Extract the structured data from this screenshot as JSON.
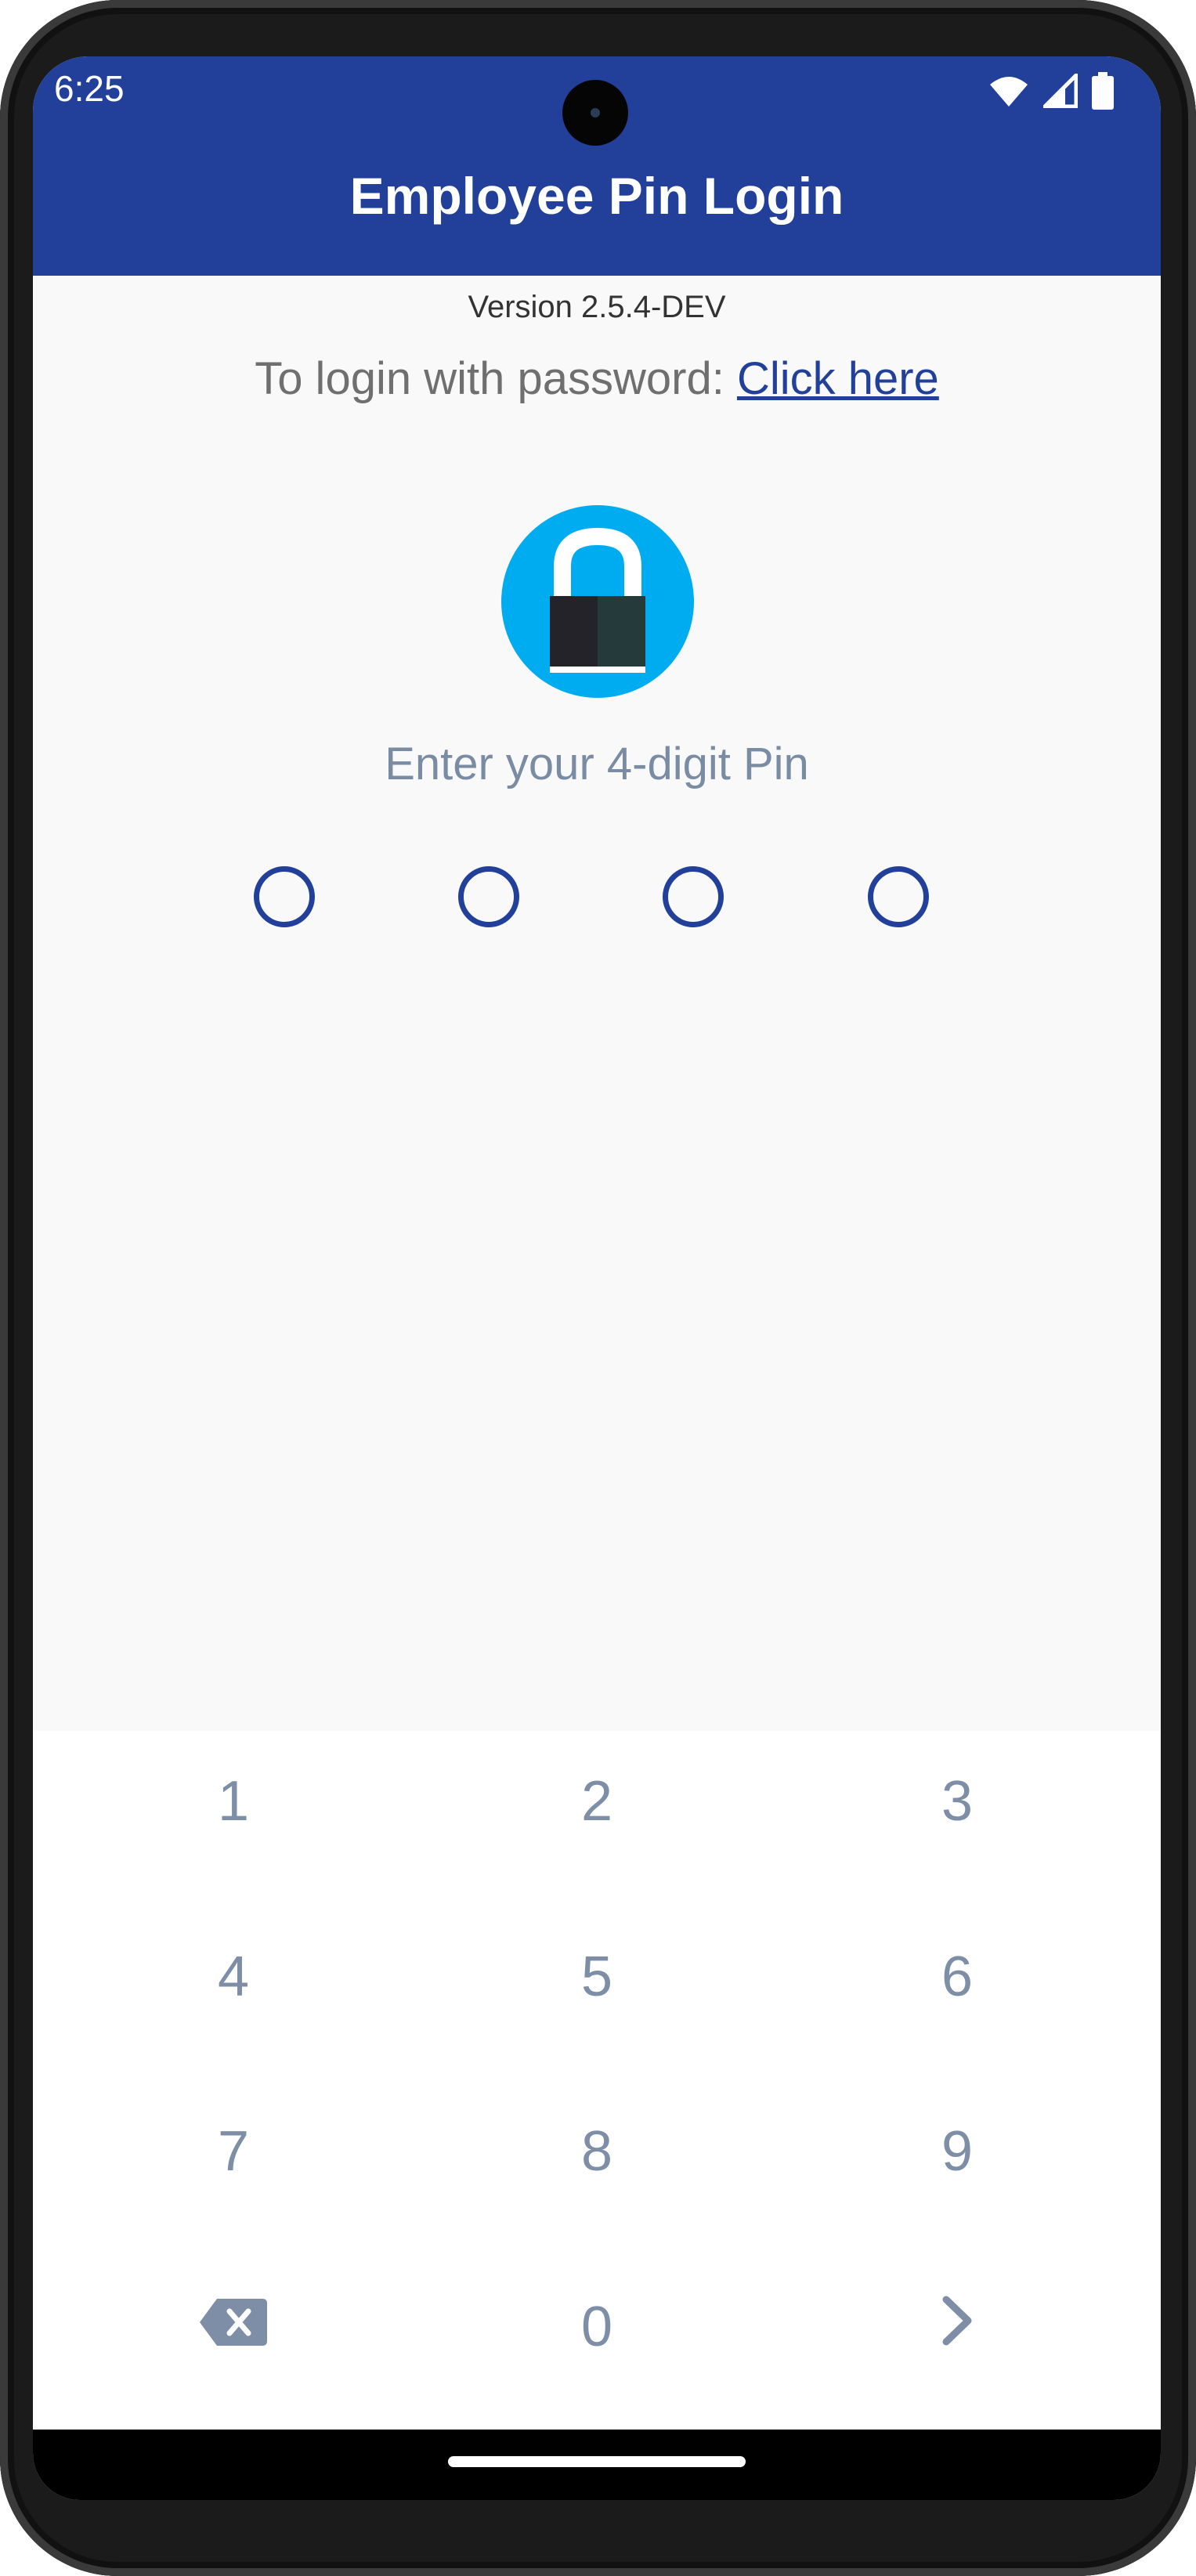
{
  "status_bar": {
    "time": "6:25",
    "icons": [
      "wifi-icon",
      "cellular-signal-icon",
      "battery-icon"
    ]
  },
  "app_bar": {
    "title": "Employee Pin Login",
    "color": "#22409a"
  },
  "version_text": "Version 2.5.4-DEV",
  "password_login": {
    "prefix": "To login with password: ",
    "link_label": "Click here"
  },
  "lock_icon": "padlock-icon",
  "pin_prompt": "Enter your 4-digit Pin",
  "pin": {
    "length": 4,
    "entered": 0
  },
  "keypad": {
    "keys": [
      "1",
      "2",
      "3",
      "4",
      "5",
      "6",
      "7",
      "8",
      "9",
      "",
      "0",
      ""
    ],
    "backspace_icon": "backspace-icon",
    "submit_icon": "chevron-right-icon"
  }
}
